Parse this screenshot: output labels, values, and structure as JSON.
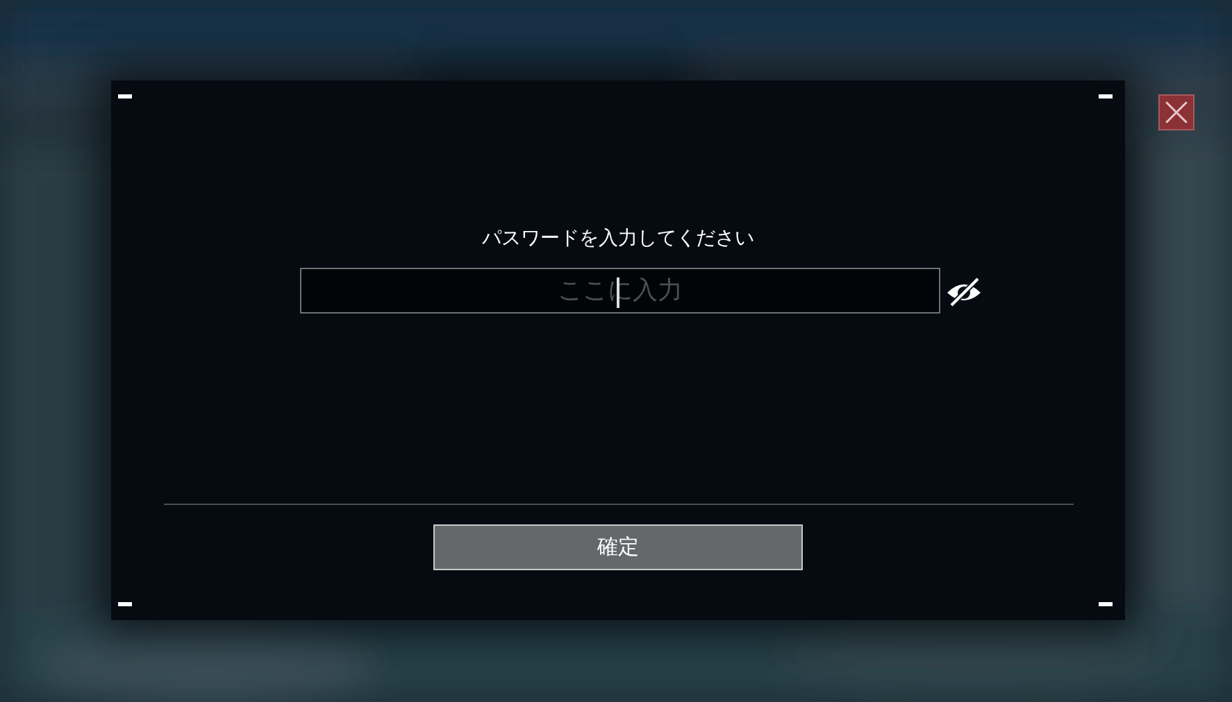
{
  "dialog": {
    "title": "パスワードを入力してください",
    "password_field": {
      "placeholder": "ここに入力",
      "focused": true
    },
    "confirm_button": {
      "label": "確定"
    }
  }
}
